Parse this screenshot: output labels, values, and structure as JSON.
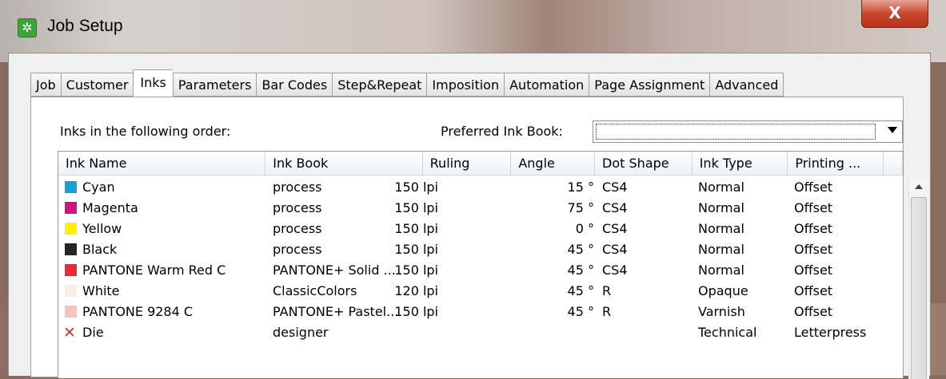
{
  "window": {
    "title": "Job Setup",
    "close_label": "X",
    "icon": "app-gear-icon"
  },
  "tabs": [
    {
      "label": "Job"
    },
    {
      "label": "Customer"
    },
    {
      "label": "Inks",
      "active": true
    },
    {
      "label": "Parameters"
    },
    {
      "label": "Bar Codes"
    },
    {
      "label": "Step&Repeat"
    },
    {
      "label": "Imposition"
    },
    {
      "label": "Automation"
    },
    {
      "label": "Page Assignment"
    },
    {
      "label": "Advanced"
    }
  ],
  "inks_panel": {
    "order_label": "Inks in the following order:",
    "preferred_label": "Preferred Ink Book:",
    "preferred_value": ""
  },
  "table": {
    "columns": [
      "Ink Name",
      "Ink Book",
      "Ruling",
      "Angle",
      "Dot Shape",
      "Ink Type",
      "Printing ..."
    ],
    "rows": [
      {
        "name": "Cyan",
        "color": "#1a9fd8",
        "book": "process",
        "ruling": "150 lpi",
        "angle": "15 °",
        "dot": "CS4",
        "type": "Normal",
        "printing": "Offset"
      },
      {
        "name": "Magenta",
        "color": "#d2127f",
        "book": "process",
        "ruling": "150 lpi",
        "angle": "75 °",
        "dot": "CS4",
        "type": "Normal",
        "printing": "Offset"
      },
      {
        "name": "Yellow",
        "color": "#fff000",
        "book": "process",
        "ruling": "150 lpi",
        "angle": "0 °",
        "dot": "CS4",
        "type": "Normal",
        "printing": "Offset"
      },
      {
        "name": "Black",
        "color": "#262626",
        "book": "process",
        "ruling": "150 lpi",
        "angle": "45 °",
        "dot": "CS4",
        "type": "Normal",
        "printing": "Offset"
      },
      {
        "name": "PANTONE Warm Red C",
        "color": "#ed2837",
        "book": "PANTONE+ Solid ...",
        "ruling": "150 lpi",
        "angle": "45 °",
        "dot": "CS4",
        "type": "Normal",
        "printing": "Offset"
      },
      {
        "name": "White",
        "color": "#fbece4",
        "book": "ClassicColors",
        "ruling": "120 lpi",
        "angle": "45 °",
        "dot": "R",
        "type": "Opaque",
        "printing": "Offset"
      },
      {
        "name": "PANTONE 9284 C",
        "color": "#f6c3c1",
        "book": "PANTONE+ Pastel...",
        "ruling": "150 lpi",
        "angle": "45 °",
        "dot": "R",
        "type": "Varnish",
        "printing": "Offset"
      },
      {
        "name": "Die",
        "color": "",
        "icon": "x-cross-icon",
        "book": "designer",
        "ruling": "",
        "angle": "",
        "dot": "",
        "type": "Technical",
        "printing": "Letterpress"
      }
    ]
  }
}
